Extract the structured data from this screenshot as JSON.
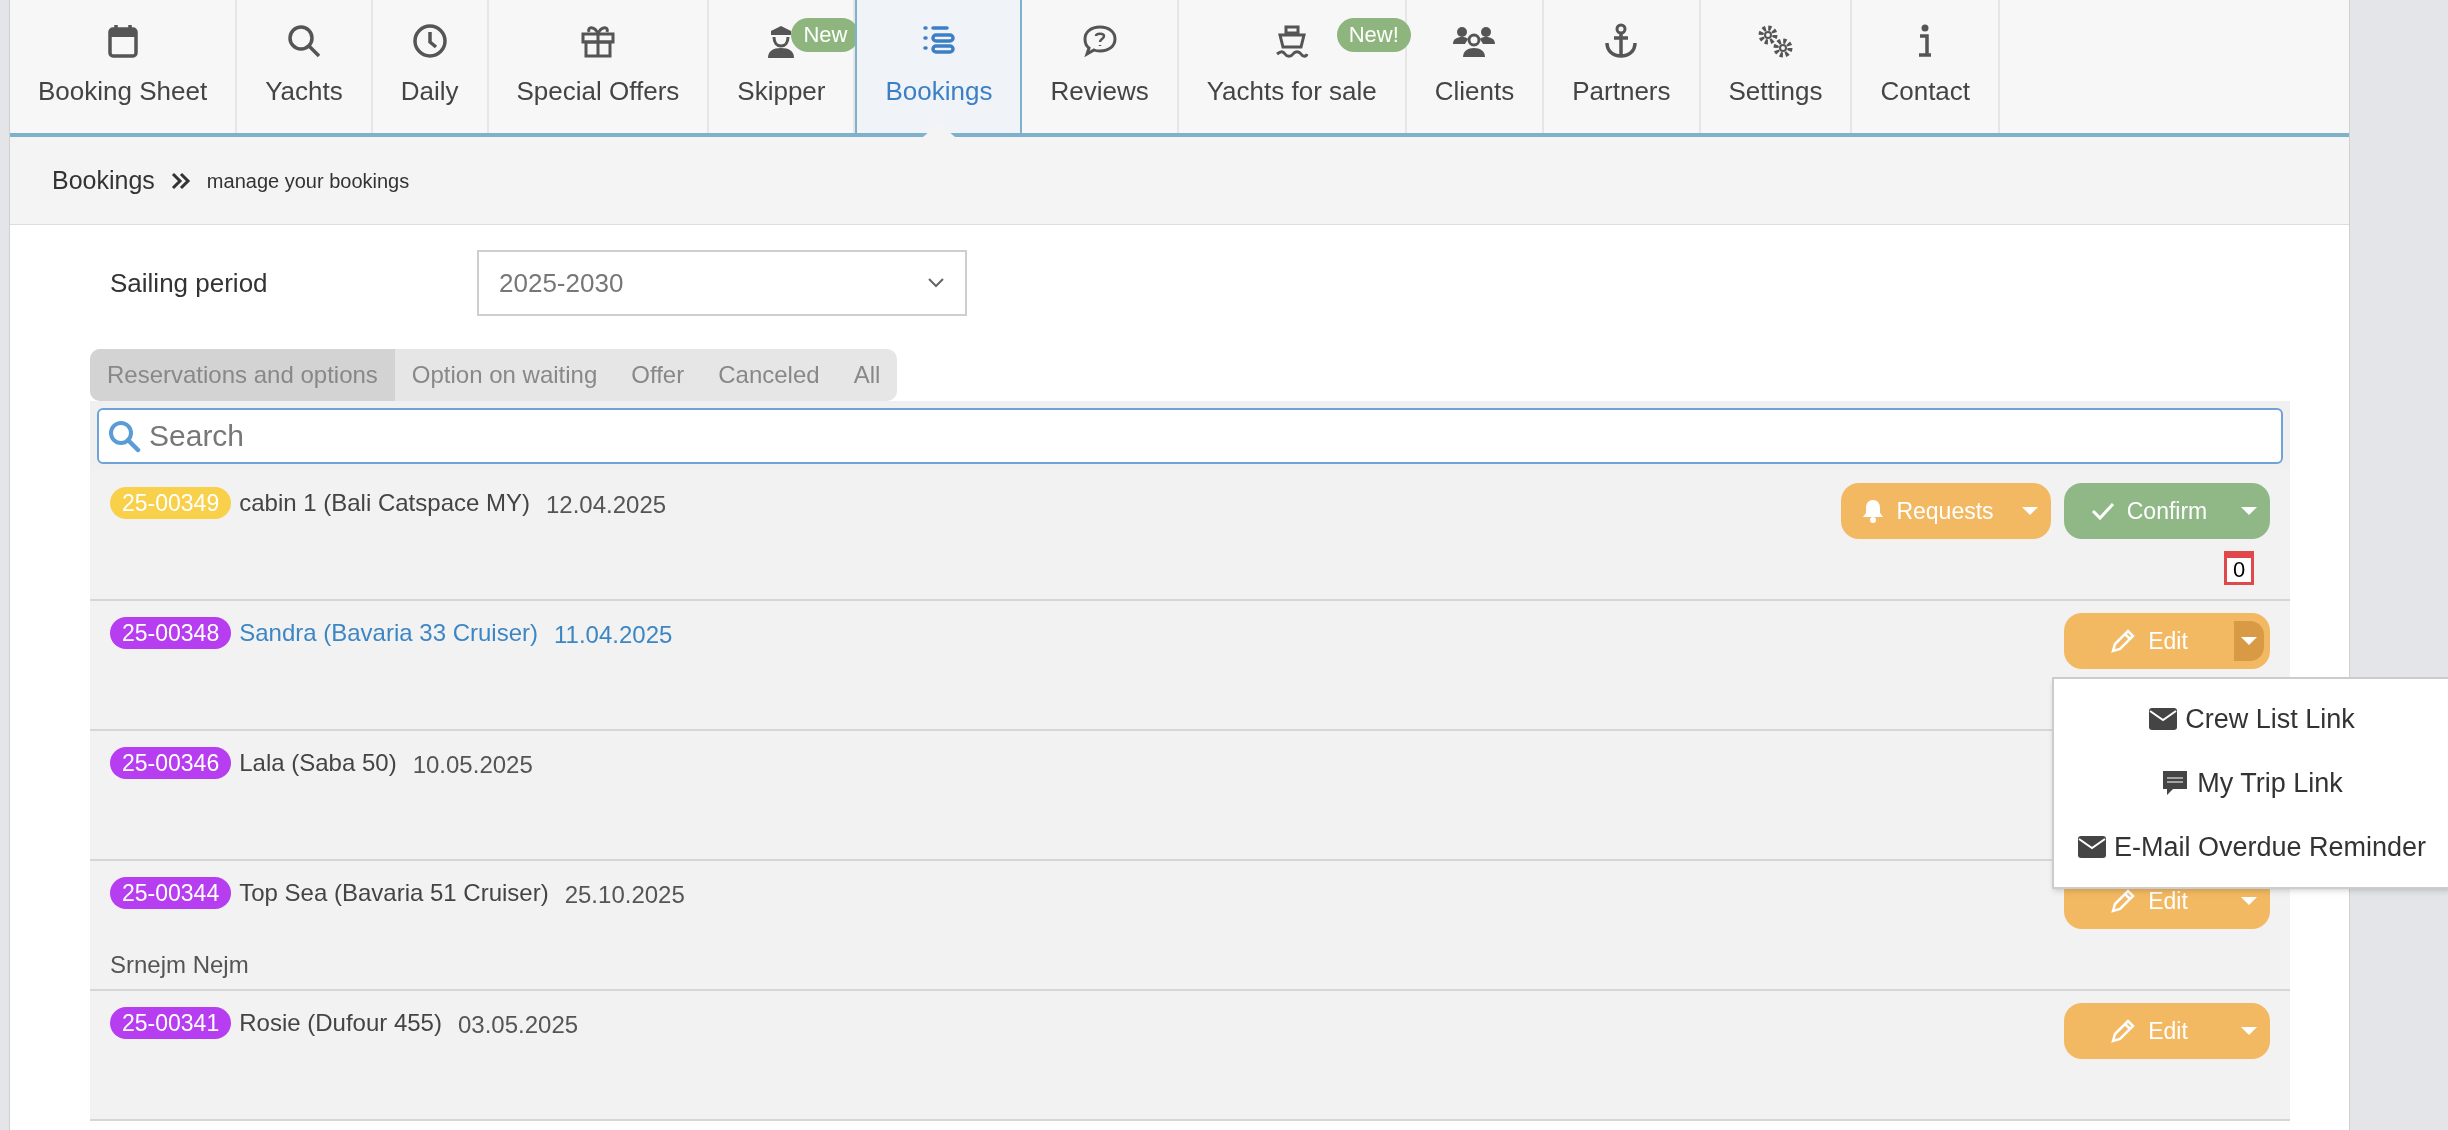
{
  "nav": [
    {
      "label": "Booking Sheet",
      "selected": false
    },
    {
      "label": "Yachts",
      "selected": false
    },
    {
      "label": "Daily",
      "selected": false
    },
    {
      "label": "Special Offers",
      "selected": false
    },
    {
      "label": "Skipper",
      "selected": false,
      "badge": "New"
    },
    {
      "label": "Bookings",
      "selected": true
    },
    {
      "label": "Reviews",
      "selected": false
    },
    {
      "label": "Yachts for sale",
      "selected": false,
      "badge": "New!"
    },
    {
      "label": "Clients",
      "selected": false
    },
    {
      "label": "Partners",
      "selected": false
    },
    {
      "label": "Settings",
      "selected": false
    },
    {
      "label": "Contact",
      "selected": false
    }
  ],
  "breadcrumb": {
    "title": "Bookings",
    "subtitle": "manage your bookings"
  },
  "sailing_period": {
    "label": "Sailing period",
    "value": "2025-2030"
  },
  "filter_tabs": [
    {
      "label": "Reservations and options",
      "selected": true
    },
    {
      "label": "Option on waiting",
      "selected": false
    },
    {
      "label": "Offer",
      "selected": false
    },
    {
      "label": "Canceled",
      "selected": false
    },
    {
      "label": "All",
      "selected": false
    }
  ],
  "search": {
    "placeholder": "Search"
  },
  "bookings": [
    {
      "number": "25-00349",
      "color": "#f8d04a",
      "title": "cabin 1 (Bali Catspace MY)",
      "date": "12.04.2025",
      "highlighted": false,
      "actions": [
        {
          "kind": "requests",
          "label": "Requests"
        },
        {
          "kind": "confirm",
          "label": "Confirm"
        }
      ],
      "calendar_count": "0"
    },
    {
      "number": "25-00348",
      "color": "#b63ef0",
      "title": "Sandra (Bavaria 33 Cruiser)",
      "date": "11.04.2025",
      "highlighted": true,
      "actions": [
        {
          "kind": "edit",
          "label": "Edit",
          "expanded": true
        }
      ],
      "menu": [
        {
          "kind": "mail",
          "label": "Crew List Link"
        },
        {
          "kind": "sms",
          "label": "My Trip Link"
        },
        {
          "kind": "mail",
          "label": "E-Mail Overdue Reminder"
        }
      ]
    },
    {
      "number": "25-00346",
      "color": "#b63ef0",
      "title": "Lala (Saba 50)",
      "date": "10.05.2025",
      "highlighted": false
    },
    {
      "number": "25-00344",
      "color": "#b63ef0",
      "title": "Top Sea (Bavaria 51 Cruiser)",
      "date": "25.10.2025",
      "highlighted": false,
      "note": "Srnejm Nejm",
      "actions": [
        {
          "kind": "edit",
          "label": "Edit",
          "expanded": false
        }
      ]
    },
    {
      "number": "25-00341",
      "color": "#b63ef0",
      "title": "Rosie (Dufour 455)",
      "date": "03.05.2025",
      "highlighted": false,
      "actions": [
        {
          "kind": "edit",
          "label": "Edit",
          "expanded": false
        }
      ]
    }
  ]
}
